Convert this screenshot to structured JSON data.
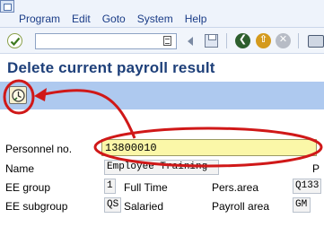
{
  "menu": {
    "items": [
      "Program",
      "Edit",
      "Goto",
      "System",
      "Help"
    ]
  },
  "toolbar": {
    "command_value": "",
    "icons": [
      "enter-icon",
      "command-doc-icon",
      "history-back-icon",
      "save-icon",
      "back-icon",
      "exit-icon",
      "cancel-icon",
      "print-icon"
    ]
  },
  "page": {
    "title": "Delete current payroll result"
  },
  "app_toolbar": {
    "execute_icon": "execute-icon"
  },
  "form": {
    "personnel_label": "Personnel no.",
    "personnel_value": "13800010",
    "name_label": "Name",
    "name_value": "Employee Training",
    "name_right_fragment": "P",
    "ee_group_label": "EE group",
    "ee_group_code": "1",
    "ee_group_text": "Full Time",
    "pers_area_label": "Pers.area",
    "pers_area_code": "Q133",
    "ee_subgroup_label": "EE subgroup",
    "ee_subgroup_code": "QS",
    "ee_subgroup_text": "Salaried",
    "payroll_area_label": "Payroll area",
    "payroll_area_code": "GM"
  },
  "colors": {
    "title": "#1d3f79",
    "menu_text": "#1a3c87",
    "app_toolbar_bg": "#aec9ef",
    "highlight_field": "#fbf7a8",
    "annotation_red": "#d01818"
  }
}
